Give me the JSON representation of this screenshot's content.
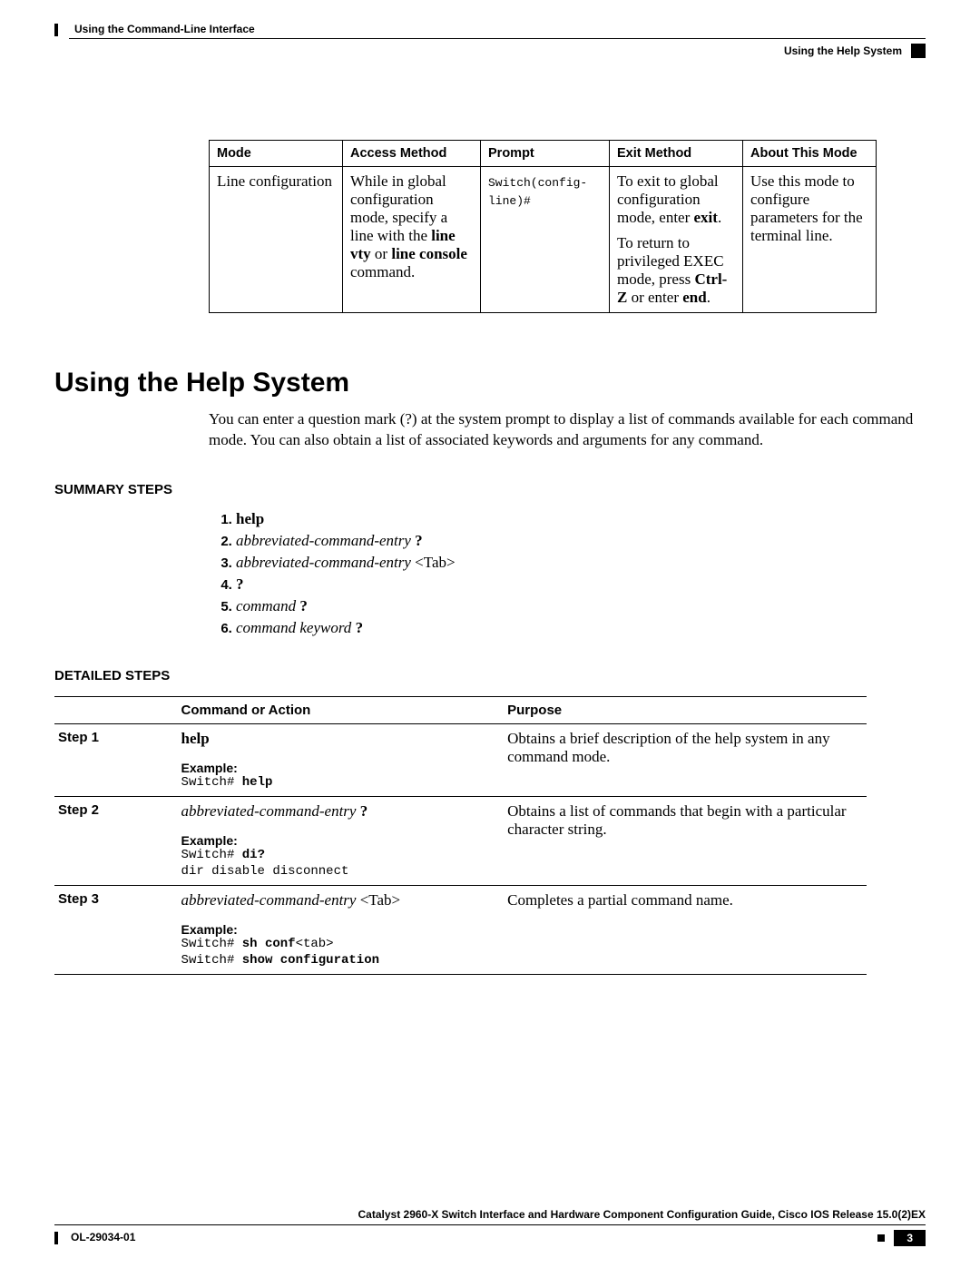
{
  "header": {
    "left": "Using the Command-Line Interface",
    "right": "Using the Help System"
  },
  "mode_table": {
    "headers": {
      "mode": "Mode",
      "access": "Access Method",
      "prompt": "Prompt",
      "exit": "Exit Method",
      "about": "About This Mode"
    },
    "row": {
      "mode": "Line configuration",
      "access_part1": "While in global configuration mode, specify a line with the ",
      "access_bold1": "line vty",
      "access_or": " or ",
      "access_bold2": "line console",
      "access_part2": " command.",
      "prompt": "Switch(config-line)#",
      "exit_part1": "To exit to global configuration mode, enter ",
      "exit_bold1": "exit",
      "exit_part2": ".",
      "exit_part3": "To return to privileged EXEC mode, press ",
      "exit_bold2": "Ctrl-Z",
      "exit_part4": " or enter ",
      "exit_bold3": "end",
      "exit_part5": ".",
      "about": "Use this mode to configure parameters for the terminal line."
    }
  },
  "section_title": "Using the Help System",
  "intro": "You can enter a question mark (?) at the system prompt to display a list of commands available for each command mode. You can also obtain a list of associated keywords and arguments for any command.",
  "summary_head": "SUMMARY STEPS",
  "summary": {
    "i1_bold": "help",
    "i2_italic": "abbreviated-command-entry",
    "i2_bold": " ?",
    "i3_italic": "abbreviated-command-entry",
    "i3_plain": " <Tab>",
    "i4_bold": "?",
    "i5_italic": "command",
    "i5_bold": " ?",
    "i6_italic": "command keyword",
    "i6_bold": " ?"
  },
  "detailed_head": "DETAILED STEPS",
  "steps_headers": {
    "step": "",
    "cmd": "Command or Action",
    "purpose": "Purpose"
  },
  "steps": {
    "s1": {
      "label": "Step 1",
      "cmd_bold": "help",
      "example_label": "Example:",
      "example_prompt": "Switch# ",
      "example_bold": "help",
      "purpose": "Obtains a brief description of the help system in any command mode."
    },
    "s2": {
      "label": "Step 2",
      "cmd_italic": "abbreviated-command-entry",
      "cmd_bold": " ?",
      "example_label": "Example:",
      "example_line1_prompt": "Switch# ",
      "example_line1_bold": "di?",
      "example_line2": "dir disable disconnect",
      "purpose": "Obtains a list of commands that begin with a particular character string."
    },
    "s3": {
      "label": "Step 3",
      "cmd_italic": "abbreviated-command-entry",
      "cmd_plain": " <Tab>",
      "example_label": "Example:",
      "example_line1_prompt": "Switch# ",
      "example_line1_bold": "sh conf",
      "example_line1_plain": "<tab>",
      "example_line2_prompt": "Switch# ",
      "example_line2_bold": "show configuration",
      "purpose": "Completes a partial command name."
    }
  },
  "footer": {
    "title": "Catalyst 2960-X Switch Interface and Hardware Component Configuration Guide, Cisco IOS Release 15.0(2)EX",
    "docid": "OL-29034-01",
    "pagenum": "3"
  }
}
